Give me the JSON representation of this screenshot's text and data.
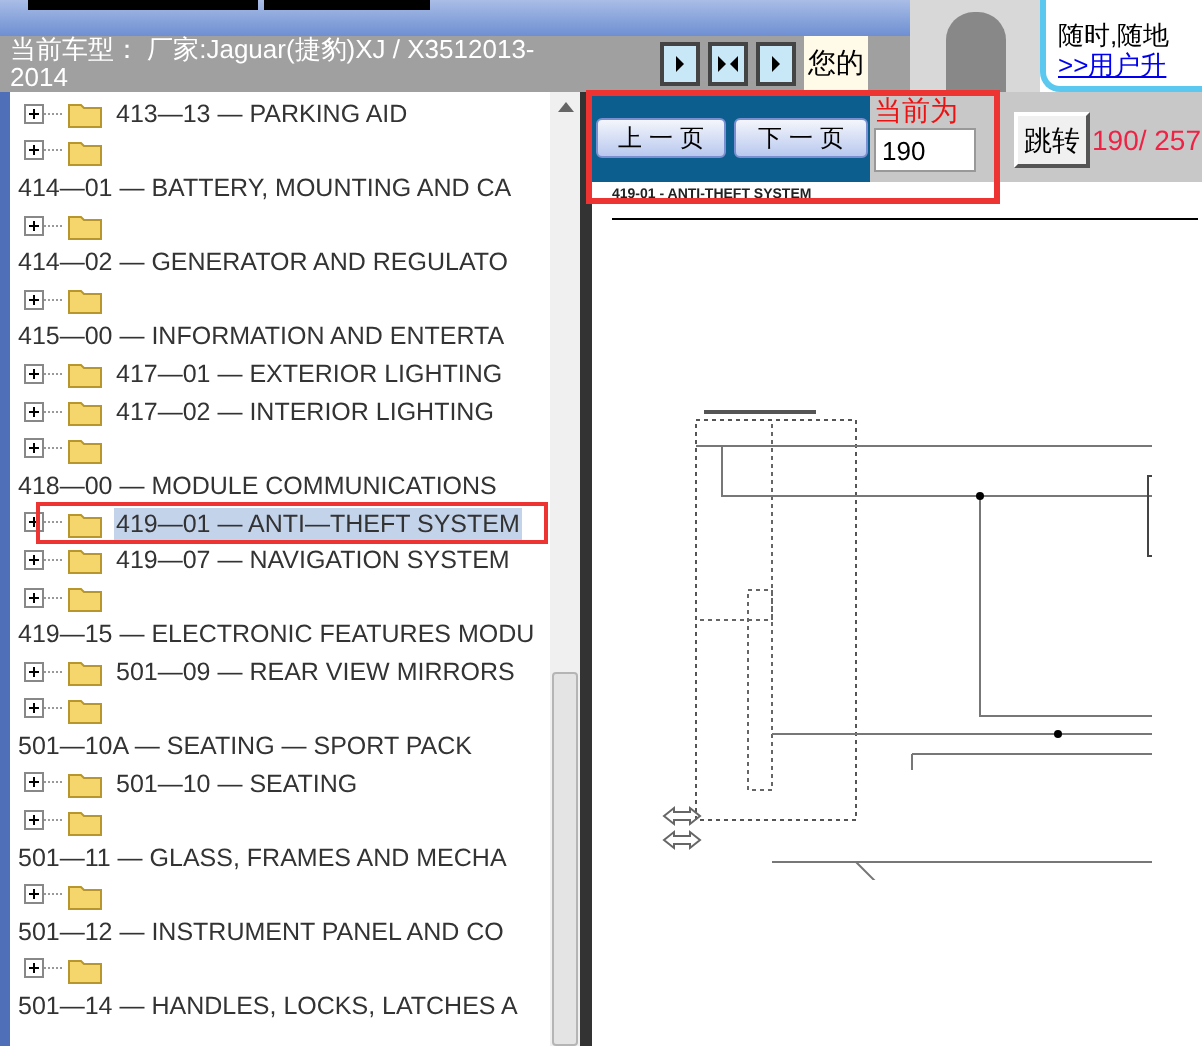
{
  "header": {
    "vehicle": "当前车型： 厂家:Jaguar(捷豹)XJ / X3512013-2014",
    "notice": "您的"
  },
  "banner": {
    "line_1": "随时,随地",
    "link": ">>用户升"
  },
  "tree": [
    {
      "kind": "node",
      "label": "413—13 — PARKING AID",
      "selected": false
    },
    {
      "kind": "icon"
    },
    {
      "kind": "text",
      "label": "414—01 — BATTERY, MOUNTING AND CA"
    },
    {
      "kind": "icon"
    },
    {
      "kind": "text",
      "label": "414—02 — GENERATOR AND REGULATO"
    },
    {
      "kind": "icon"
    },
    {
      "kind": "text",
      "label": "415—00 — INFORMATION AND ENTERTA"
    },
    {
      "kind": "node",
      "label": "417—01 — EXTERIOR LIGHTING",
      "selected": false
    },
    {
      "kind": "node",
      "label": "417—02 — INTERIOR LIGHTING",
      "selected": false
    },
    {
      "kind": "icon"
    },
    {
      "kind": "text",
      "label": "418—00 — MODULE COMMUNICATIONS"
    },
    {
      "kind": "node",
      "label": "419—01 — ANTI—THEFT SYSTEM",
      "selected": true
    },
    {
      "kind": "node",
      "label": "419—07 — NAVIGATION SYSTEM",
      "selected": false
    },
    {
      "kind": "icon"
    },
    {
      "kind": "text",
      "label": "419—15 — ELECTRONIC FEATURES MODU"
    },
    {
      "kind": "node",
      "label": "501—09 — REAR VIEW MIRRORS",
      "selected": false
    },
    {
      "kind": "icon"
    },
    {
      "kind": "text",
      "label": "501—10A — SEATING — SPORT PACK"
    },
    {
      "kind": "node",
      "label": "501—10 — SEATING",
      "selected": false
    },
    {
      "kind": "icon"
    },
    {
      "kind": "text",
      "label": "501—11 — GLASS, FRAMES AND MECHA"
    },
    {
      "kind": "icon"
    },
    {
      "kind": "text",
      "label": "501—12 — INSTRUMENT PANEL AND CO"
    },
    {
      "kind": "icon"
    },
    {
      "kind": "text",
      "label": "501—14 — HANDLES, LOCKS, LATCHES A"
    }
  ],
  "pager": {
    "prev": "上 一 页",
    "next": "下 一 页",
    "current_label": "当前为",
    "page_value": "190",
    "go": "跳转",
    "page_count": "190/ 257"
  },
  "document": {
    "title": "419-01 - ANTI-THEFT SYSTEM"
  }
}
